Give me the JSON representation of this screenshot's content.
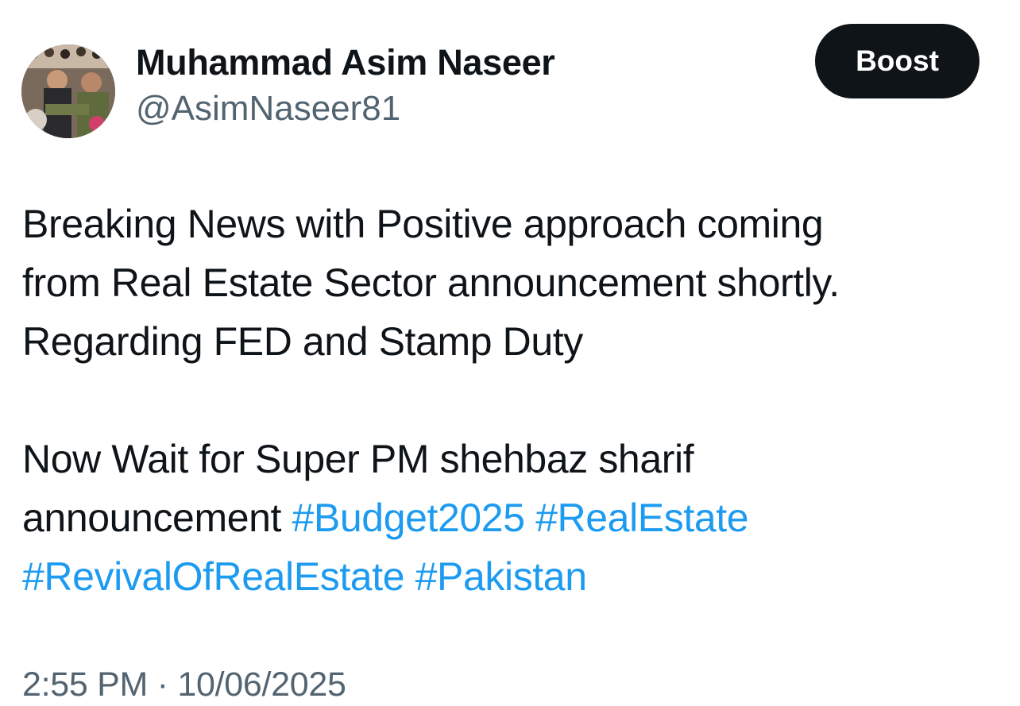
{
  "author": {
    "display_name": "Muhammad Asim Naseer",
    "handle": "@AsimNaseer81"
  },
  "actions": {
    "boost_label": "Boost"
  },
  "tweet": {
    "line1": "Breaking News with Positive approach coming",
    "line2": "from Real Estate Sector announcement shortly.",
    "line3": "Regarding FED and Stamp Duty",
    "line4": "Now Wait for Super PM shehbaz sharif",
    "line5_text": "announcement ",
    "hashtags": [
      "#Budget2025",
      "#RealEstate",
      "#RevivalOfRealEstate",
      "#Pakistan"
    ]
  },
  "meta": {
    "timestamp": "2:55 PM · 10/06/2025"
  },
  "colors": {
    "text": "#0f1419",
    "secondary": "#536471",
    "link": "#1d9bf0",
    "button_bg": "#0f1419"
  }
}
